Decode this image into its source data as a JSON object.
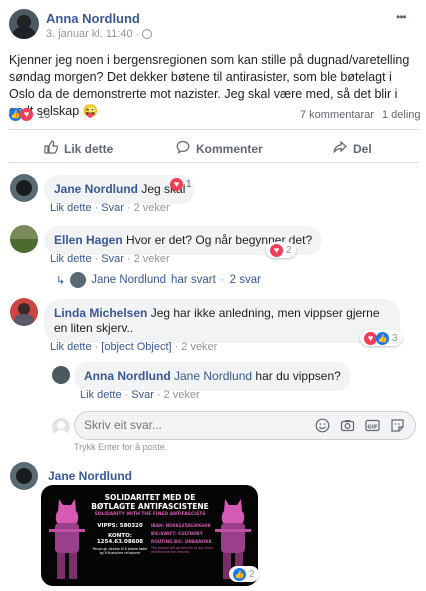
{
  "post": {
    "author": "Anna Nordlund",
    "date": "3. januar kl. 11:40",
    "globe": "🌐",
    "more": "•••",
    "text": "Kjenner jeg noen i bergensregionen som kan stille på dugnad/varetelling søndag morgen? Det dekker bøtene til antirasister, som ble bøtelagt i Oslo da de demonstrerte mot nazister. Jeg skal være med, så det blir i godt selskap 😜",
    "reaction_count": "13",
    "comments_count": "7 kommentarar",
    "shares": "1 deling"
  },
  "actions": {
    "like": "Lik dette",
    "comment": "Kommenter",
    "share": "Del"
  },
  "comments": [
    {
      "author": "Jane Nordlund",
      "text": "Jeg skal",
      "react_count": "1",
      "like": "Lik dette",
      "reply": "Svar",
      "time": "2 veker"
    },
    {
      "author": "Ellen Hagen",
      "text": "Hvor er det? Og når begynner det?",
      "react_count": "2",
      "like": "Lik dette",
      "reply": "Svar",
      "time": "2 veker",
      "reply_summary": {
        "author": "Jane Nordlund",
        "label": "har svart",
        "time": "2 svar"
      }
    },
    {
      "author": "Linda Michelsen",
      "text": "Jeg har ikke anledning, men vippser gjerne en liten skjerv..",
      "react_count": "3",
      "like": "Lik dette",
      "reply": {
        "author": "Anna Nordlund",
        "mention": "Jane Nordlund",
        "text": " har du vippsen?",
        "like": "Lik dette",
        "reply": "Svar",
        "time": "2 veker"
      },
      "time": "2 veker"
    }
  ],
  "reply_box": {
    "placeholder": "Skriv eit svar...",
    "hint": "Trykk Enter for å poste."
  },
  "last_comment": {
    "author": "Jane Nordlund",
    "react_count": "2",
    "image": {
      "title1": "SOLIDARITET MED DE",
      "title2": "BØTLAGTE ANTIFASCISTENE",
      "subtitle": "SOLIDARITY WITH THE FINED ANTIFASCISTS",
      "vipps": "VIPPS: 580320",
      "konto": "KONTO: 1254.63.08608",
      "note": "Penge gir direkte til å betale bøter og å finansiere refusjoner",
      "iban": "IBAN: NO8812546306608",
      "bic": "BIC/SWIFT: CULTNOKY",
      "routing": "ROUTING BIC: DNBANOKK",
      "small": "The money will go directly to pay fines and finance the refunds"
    }
  }
}
